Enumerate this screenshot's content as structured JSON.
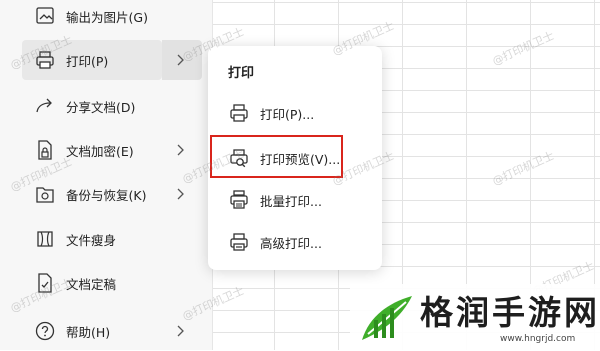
{
  "menu": {
    "items": [
      {
        "label": "输出为图片(G)",
        "icon": "image-export-icon",
        "has_arrow": false
      },
      {
        "label": "打印(P)",
        "icon": "printer-icon",
        "has_arrow": true,
        "active": true
      },
      {
        "label": "分享文档(D)",
        "icon": "share-icon",
        "has_arrow": false
      },
      {
        "label": "文档加密(E)",
        "icon": "document-lock-icon",
        "has_arrow": true
      },
      {
        "label": "备份与恢复(K)",
        "icon": "backup-restore-icon",
        "has_arrow": true
      },
      {
        "label": "文件瘦身",
        "icon": "file-slim-icon",
        "has_arrow": false
      },
      {
        "label": "文档定稿",
        "icon": "document-finalize-icon",
        "has_arrow": false
      },
      {
        "label": "帮助(H)",
        "icon": "help-icon",
        "has_arrow": true
      }
    ]
  },
  "submenu": {
    "title": "打印",
    "items": [
      {
        "label": "打印(P)...",
        "icon": "printer-icon"
      },
      {
        "label": "打印预览(V)...",
        "icon": "print-preview-icon",
        "highlighted": true
      },
      {
        "label": "批量打印...",
        "icon": "batch-print-icon"
      },
      {
        "label": "高级打印...",
        "icon": "advanced-print-icon"
      }
    ]
  },
  "watermark": "@打印机卫士",
  "logo": {
    "title": "格润手游网",
    "url": "www.hngrjd.com"
  },
  "colors": {
    "highlight_border": "#d9251c",
    "logo_green": "#3fae2a",
    "menu_bg": "#f7f7f7"
  }
}
